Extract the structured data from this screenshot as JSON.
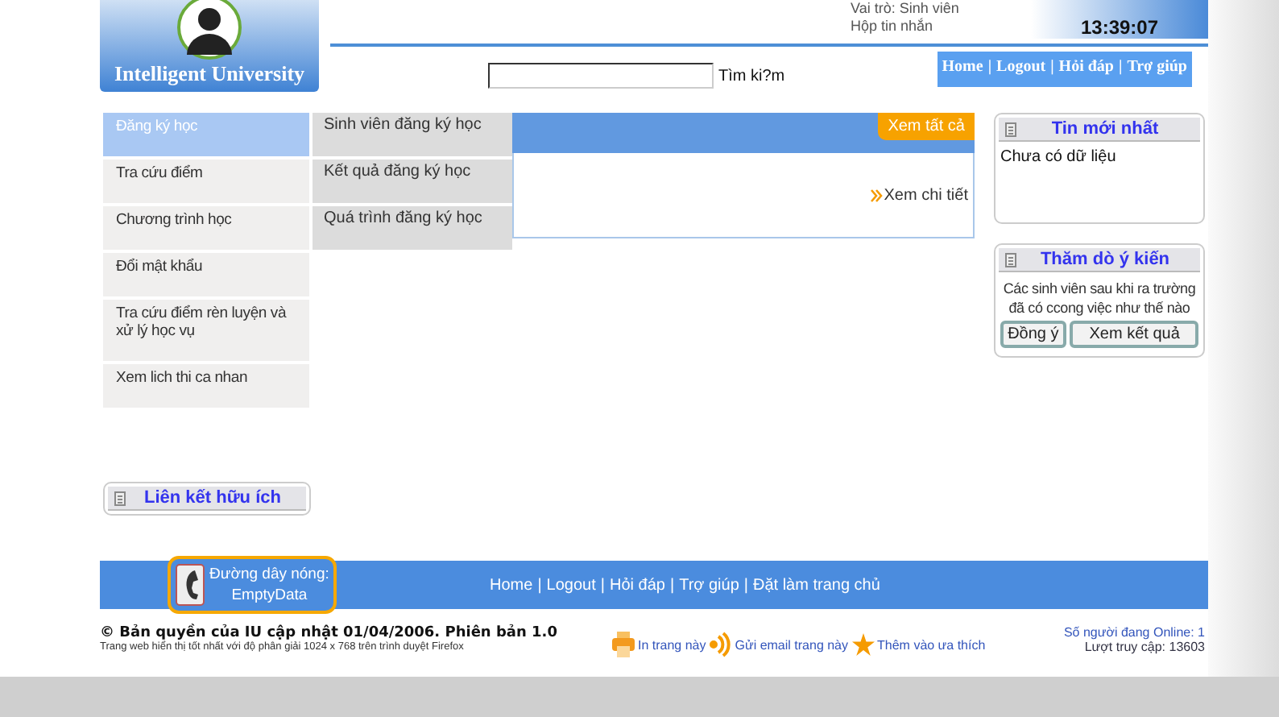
{
  "header": {
    "logo_text": "Intelligent University",
    "role": "Vai trò: Sinh viên",
    "messages_link": "Hộp tin nhắn",
    "clock": "13:39:07",
    "search": {
      "button_label": "Tìm ki?m"
    },
    "nav_links": [
      "Home",
      "Logout",
      "Hỏi đáp",
      "Trợ giúp"
    ],
    "separator": "|"
  },
  "menu": {
    "items": [
      {
        "label": "Đăng ký học",
        "selected": true
      },
      {
        "label": "Tra cứu điểm",
        "selected": false
      },
      {
        "label": "Chương trình học",
        "selected": false
      },
      {
        "label": "Đổi mật khẩu",
        "selected": false
      },
      {
        "label": "Tra cứu điểm rèn luyện và xử lý học vụ",
        "selected": false
      },
      {
        "label": "Xem lich thi ca nhan",
        "selected": false
      }
    ],
    "submenu": [
      "Sinh viên đăng ký học",
      "Kết quả đăng ký học",
      "Quá trình đăng ký học"
    ]
  },
  "content": {
    "view_all": "Xem tất cả",
    "detail_link": "Xem chi tiết"
  },
  "links_box": {
    "title": "Liên kết hữu ích"
  },
  "news_box": {
    "title": "Tin mới nhất",
    "body": "Chưa có dữ liệu"
  },
  "poll_box": {
    "title": "Thăm dò ý kiến",
    "question": "Các sinh viên sau khi ra trường đã có ccong việc như thế nào",
    "buttons": [
      "Đồng ý",
      "Xem kết quả"
    ]
  },
  "footer": {
    "hotline_label": "Đường dây nóng:",
    "hotline_value": "EmptyData",
    "links": [
      "Home",
      "Logout",
      "Hỏi đáp",
      "Trợ giúp",
      "Đặt làm trang chủ"
    ],
    "separator": "|",
    "copyright": "© Bản quyền của IU cập nhật 01/04/2006. Phiên bản 1.0",
    "note": "Trang web hiển thị tốt nhất với độ phân giải 1024 x 768 trên trình duyệt Firefox",
    "actions": [
      {
        "kind": "print",
        "label": "In trang này"
      },
      {
        "kind": "rss",
        "label": "Gửi email trang này"
      },
      {
        "kind": "star",
        "label": "Thêm vào ưa thích"
      }
    ],
    "online": "Số người đang Online: 1",
    "visits": "Lượt truy cập: 13603"
  }
}
